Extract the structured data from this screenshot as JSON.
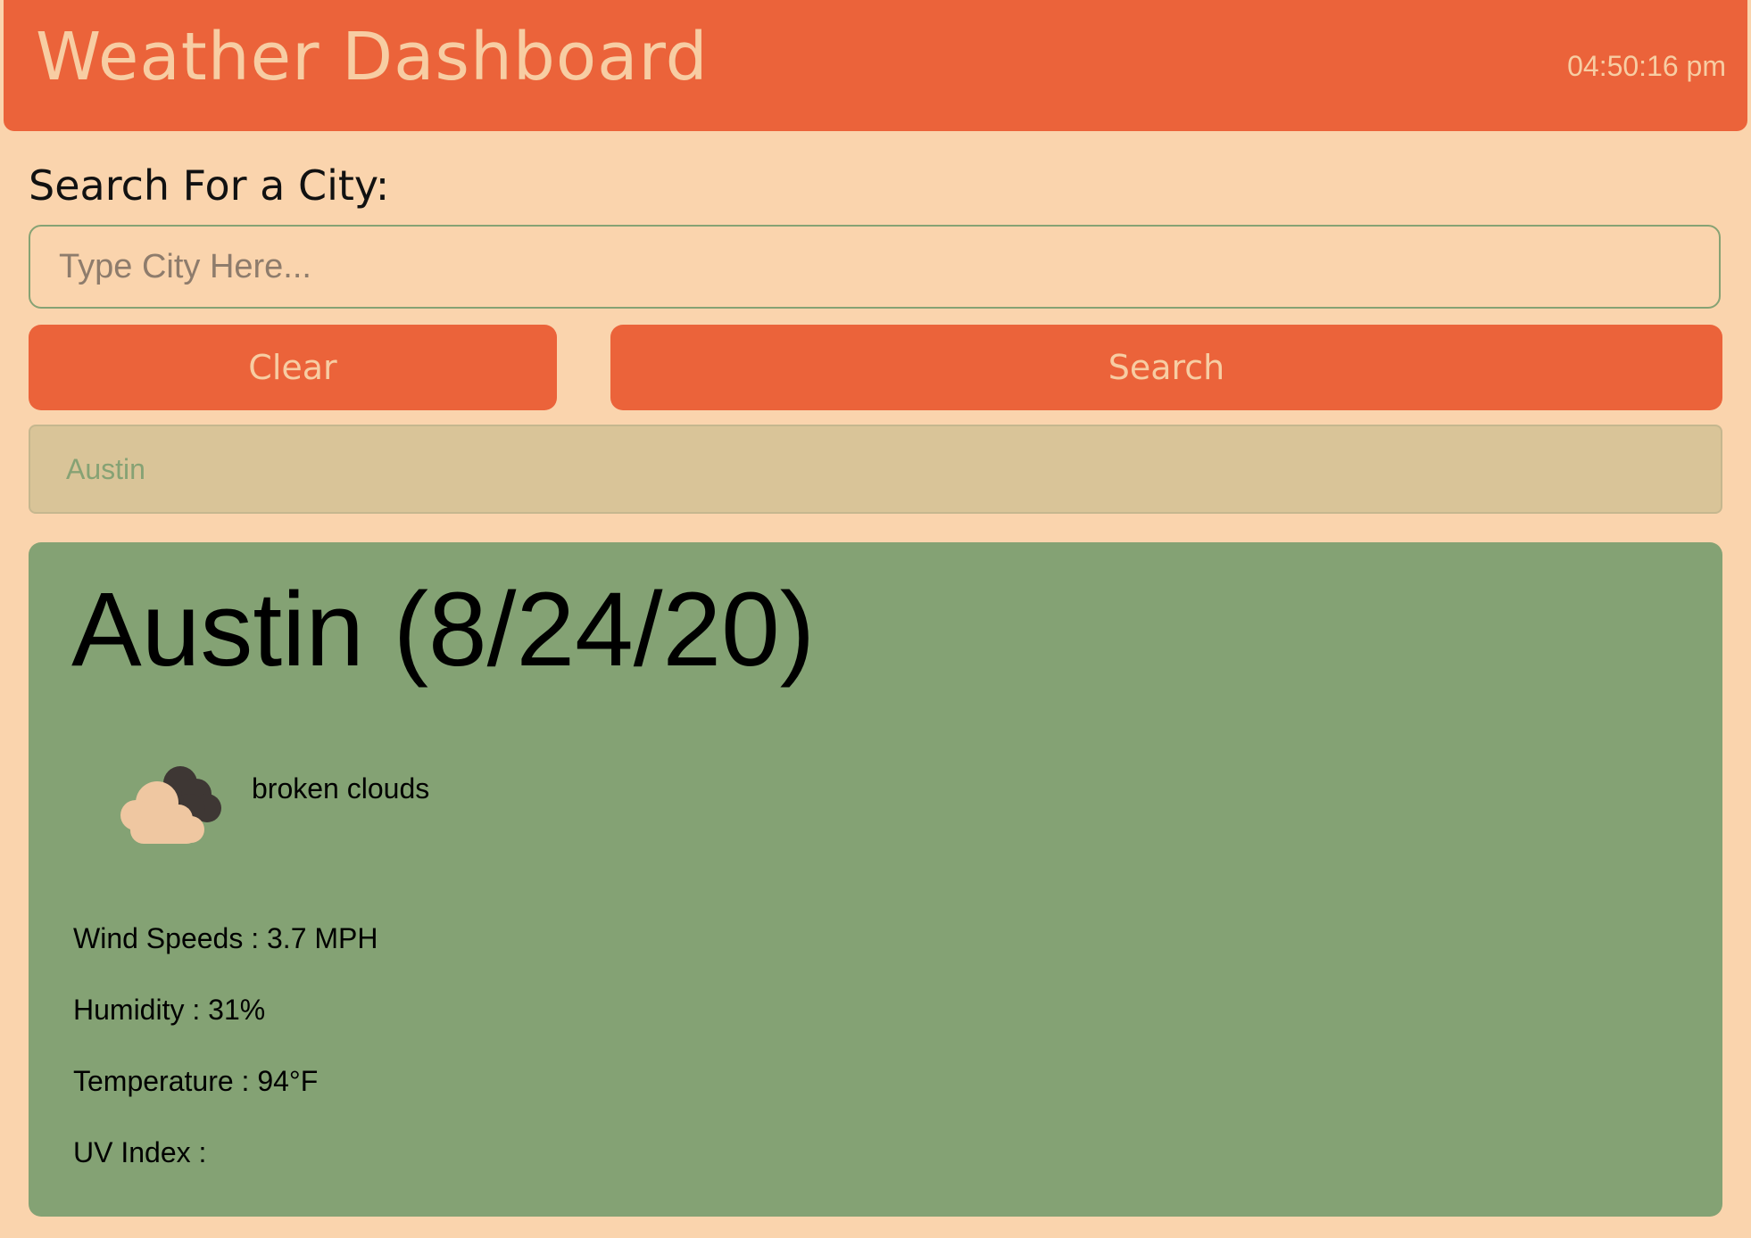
{
  "header": {
    "title": "Weather Dashboard",
    "clock": "04:50:16 pm"
  },
  "search": {
    "heading": "Search For a City:",
    "placeholder": "Type City Here...",
    "value": "",
    "clear_label": "Clear",
    "search_label": "Search"
  },
  "history": {
    "items": [
      {
        "label": "Austin"
      }
    ]
  },
  "current": {
    "title": "Austin (8/24/20)",
    "icon": "broken-clouds-icon",
    "description": "broken clouds",
    "wind": "Wind Speeds : 3.7 MPH",
    "humidity": "Humidity : 31%",
    "temperature": "Temperature : 94°F",
    "uv_index": "UV Index :"
  },
  "colors": {
    "page_background": "#fad4ad",
    "accent": "#eb633a",
    "header_text": "#f7cda3",
    "card_background": "#84a274",
    "history_background": "#d9c498",
    "history_text": "#86a274",
    "cloud_light": "#efc7a1",
    "cloud_dark": "#3e3734"
  }
}
